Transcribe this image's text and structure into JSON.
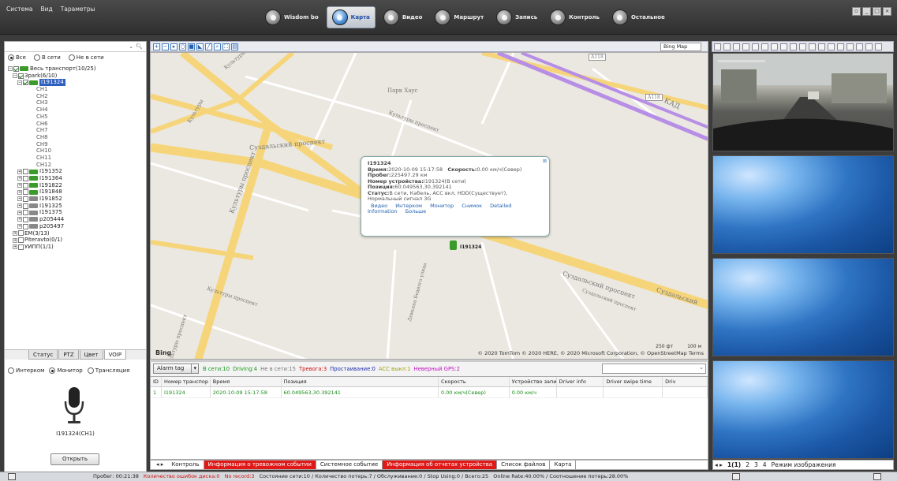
{
  "menu": [
    "Система",
    "Вид",
    "Tараметры"
  ],
  "nav": [
    {
      "label": "Wisdom bo",
      "active": false
    },
    {
      "label": "Карта",
      "active": true
    },
    {
      "label": "Видео",
      "active": false
    },
    {
      "label": "Маршрут",
      "active": false
    },
    {
      "label": "Запись",
      "active": false
    },
    {
      "label": "Контроль",
      "active": false
    },
    {
      "label": "Остальное",
      "active": false
    }
  ],
  "left": {
    "filters": {
      "all": "Все",
      "online": "В сети",
      "offline": "Не в сети"
    },
    "tree": {
      "root": "Весь транспорт(10/25)",
      "group": "Зpark(6/10)",
      "selected": "I191324",
      "channels": [
        "CH1",
        "CH2",
        "CH3",
        "CH4",
        "CH5",
        "CH6",
        "CH7",
        "CH8",
        "CH9",
        "CH10",
        "CH11",
        "CH12"
      ],
      "vehicles": [
        "I191352",
        "I191364",
        "I191822",
        "I191848",
        "I191852",
        "I191325",
        "I191375",
        "p205444",
        "p205497"
      ],
      "other_groups": [
        "EM(3/13)",
        "Piteravto(0/1)",
        "УИПП(1/1)"
      ]
    },
    "tabs": [
      "Статус",
      "PTZ",
      "Цвет",
      "VOIP"
    ],
    "voip": {
      "modes": [
        "Интерком",
        "Монитор",
        "Трансляция"
      ],
      "device": "I191324(CH1)",
      "open_button": "Открыть"
    }
  },
  "map": {
    "provider_select": "Bing Map",
    "labels": {
      "park": "Парк Хаус",
      "kad": "КАД",
      "a118_1": "A118",
      "a118_2": "A118",
      "suzd1": "Суздальский проспект",
      "suzd2": "Суздальский проспект",
      "suzd3": "Суздальский",
      "suzd4": "Суздальский проспект",
      "kult1": "Культуры проспект",
      "kult2": "Культуры проспект",
      "kult3": "Культуры",
      "kult4": "Культуры проспект",
      "kult5": "Культуры проспект",
      "kult6": "Культуры",
      "dem": "Демьяна Бедного улица",
      "bing": "Bing",
      "car": "I191324"
    },
    "attribution": "© 2020 TomTom © 2020 HERE, © 2020 Microsoft Corporation, © OpenStreetMap  Terms",
    "scale": [
      "250 фт",
      "100 м"
    ],
    "popup": {
      "title": "I191324",
      "time_label": "Время:",
      "time": "2020-10-09 15:17:58",
      "speed_label": "Скорость:",
      "speed": "0.00 км/ч(Север)",
      "mileage_label": "Пробег:",
      "mileage": "225497.29 км",
      "device_label": "Номер устройства:",
      "device": "I191324(В сети)",
      "position_label": "Позиция:",
      "position": "60.049563,30.392141",
      "status_label": "Статус:",
      "status": "В сети, Кабель, ACC вкл, HDD(Существует),",
      "signal": "Нормальный сигнал 3G",
      "links": [
        "Видео",
        "Интерком",
        "Монитор",
        "Снимок",
        "Detailed",
        "Information",
        "Больше"
      ]
    }
  },
  "alarmbar": {
    "tag": "Alarm tag",
    "counts": [
      {
        "text": "В сети:10",
        "color": "#1a9a1a"
      },
      {
        "text": "Driving:4",
        "color": "#1a9a1a"
      },
      {
        "text": "Не в сети:15",
        "color": "#777777"
      },
      {
        "text": "Тревога:3",
        "color": "#d01010"
      },
      {
        "text": "Простаивание:0",
        "color": "#1a2ab0"
      },
      {
        "text": "ACC выкл:1",
        "color": "#a0a010"
      },
      {
        "text": "Неверный GPS:2",
        "color": "#c010c0"
      }
    ]
  },
  "table": {
    "headers": [
      "ID",
      "Номер транспор",
      "Время",
      "Позиция",
      "Скорость",
      "Устройство записи скс",
      "Driver info",
      "Driver swipe time",
      "Driv"
    ],
    "rows": [
      [
        "1",
        "I191324",
        "2020-10-09 15:17:58",
        "60.049563,30.392141",
        "0.00 км/ч(Север)",
        "0.00 км/ч",
        "",
        "",
        ""
      ]
    ]
  },
  "bottomtabs": [
    {
      "label": "Контроль",
      "red": false
    },
    {
      "label": "Информация о тревожном событии",
      "red": true
    },
    {
      "label": "Системное событие",
      "red": false
    },
    {
      "label": "Информация об отчетах устройства",
      "red": true
    },
    {
      "label": "Список файлов",
      "red": false
    },
    {
      "label": "Карта",
      "red": false
    }
  ],
  "videotabs": [
    "1(1)",
    "2",
    "3",
    "4",
    "Режим изображения"
  ],
  "statusbar": [
    {
      "text": "Пробег: 00:21:38",
      "red": false
    },
    {
      "text": "Количество ошибок диска:0",
      "red": true
    },
    {
      "text": "No record:3",
      "red": true
    },
    {
      "text": "Состояние сети:10 / Количество потерь:7 / Обслуживание:0 / Stop Using:0 / Всего:25",
      "red": false
    },
    {
      "text": "Online Rate:40.00% / Соотношение потерь:28.00%",
      "red": false
    }
  ],
  "colors": {
    "accent": "#2f5fbf",
    "online": "#1a9a1a",
    "alarm": "#e01818"
  }
}
